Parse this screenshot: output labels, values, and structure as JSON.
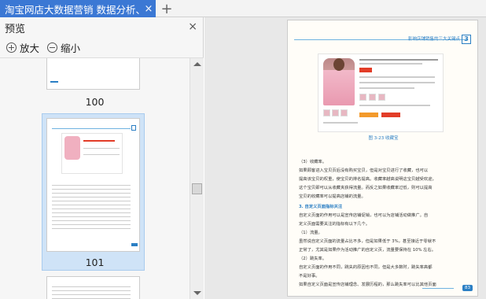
{
  "tabbar": {
    "active_tab": "淘宝网店大数据营销 数据分析、",
    "close_glyph": "×",
    "new_tab_glyph": "+"
  },
  "preview": {
    "title": "预览",
    "close_glyph": "×",
    "zoom_in_label": "放大",
    "zoom_out_label": "缩小",
    "pages": [
      {
        "number": "100"
      },
      {
        "number": "101",
        "selected": true
      }
    ]
  },
  "viewer": {
    "header_text": "影响店铺销售的三大关键点",
    "chapter_number": "3",
    "caption": "图 3-23  收藏宝",
    "section_title": "3. 自定义页面指标关注",
    "page_number": "83",
    "lines": [
      "（3）收藏率。",
      "如果顾客进入宝贝页后没有购买宝贝，但是对宝贝进行了收藏，也可以",
      "提高该宝贝的权重，使宝贝的排名提高。收藏率越高说明这宝贝越受欢迎，",
      "这个宝贝即可以从收藏夹获得流量。而反之如果收藏率过低，则可以提高",
      "宝贝的收藏率可以提高店铺的流量。",
      "3. 自定义页面指标关注",
      "自定义页面的作用可以是宣传店铺促销，也可以为店铺活动做推广。自",
      "定义页面需要关注的指标有以下几个。",
      "（1）流量。",
      "虽然说自定义页面的流量占比不多，但是如果低于 3%，甚至接近于零就不",
      "正常了，尤其是如果作为活动推广的自定义页，流量要保持在 10% 左右。",
      "（2）跳失率。",
      "自定义页面的作用不同，跳失的原因也不同，但是大多数时，跳失率高都",
      "不是好事。",
      "如果自定义页面是宣传店铺理念、发展历程的，那么跳失率可以比其他页面"
    ]
  },
  "colors": {
    "tab_active": "#3b78d4",
    "selection": "#cfe3f7",
    "accent": "#2b7fc4"
  }
}
